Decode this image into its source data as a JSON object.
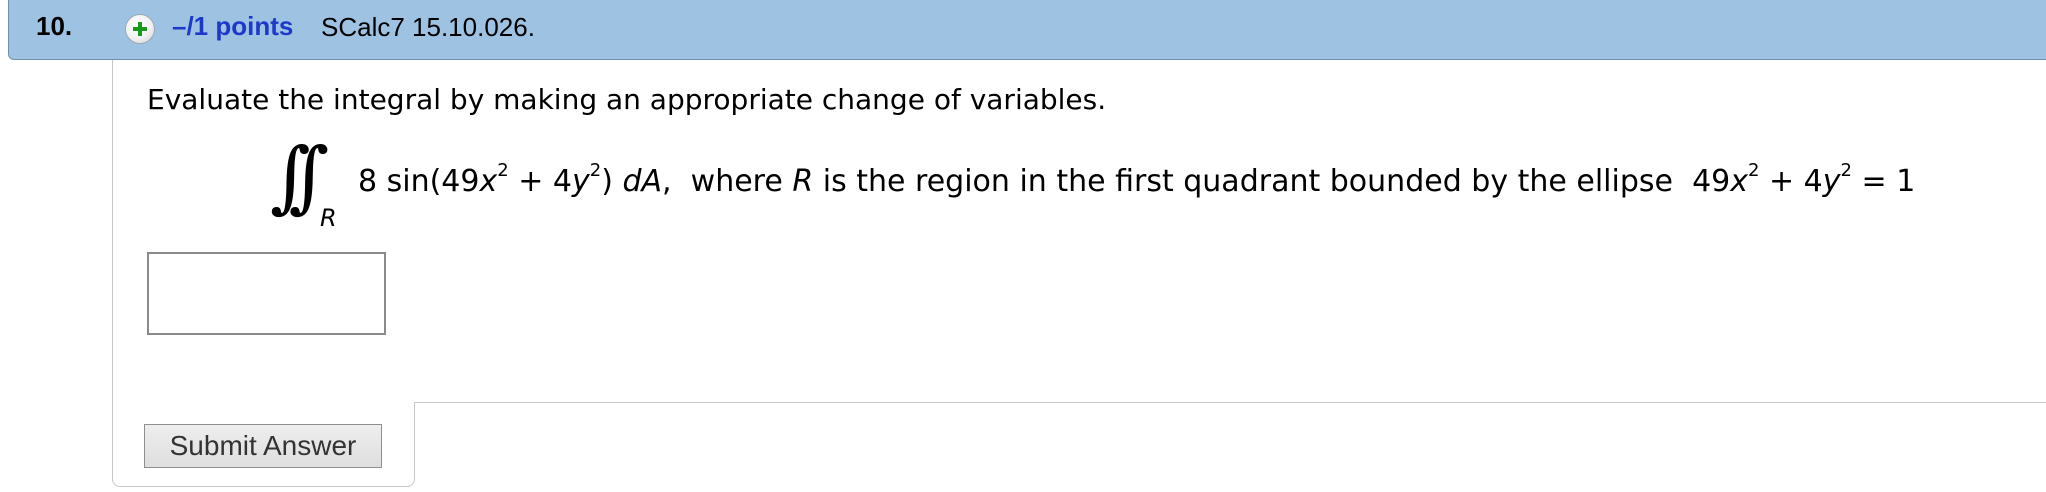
{
  "question": {
    "number": "10.",
    "points": "–/1 points",
    "id": "SCalc7 15.10.026."
  },
  "icons": {
    "expand": "plus-circle-icon"
  },
  "colors": {
    "header_bg": "#9ec3e2",
    "points_text": "#1c39c9",
    "plus_icon": "#1a9a1a"
  },
  "prompt": "Evaluate the integral by making an appropriate change of variables.",
  "math": {
    "integral_symbol": "∫∫",
    "region_subscript": "R",
    "integrand_coeff": "8 sin(49",
    "var_x": "x",
    "exp_2": "2",
    "plus_4": " + 4",
    "var_y": "y",
    "close": ") ",
    "dA": "dA",
    "comma": ",",
    "where_text": "where ",
    "R": "R",
    "region_text": " is the region in the first quadrant bounded by the ellipse ",
    "ellipse_49": "49",
    "ellipse_plus4": " + 4",
    "ellipse_eq": " = 1"
  },
  "answer": {
    "value": ""
  },
  "submit": {
    "label": "Submit Answer"
  }
}
